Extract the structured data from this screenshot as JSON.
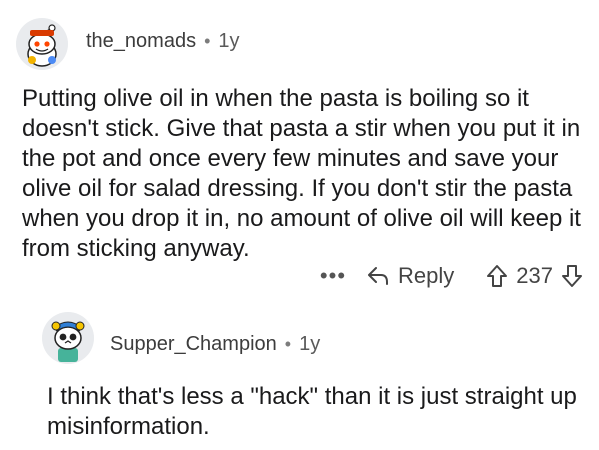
{
  "comments": [
    {
      "username": "the_nomads",
      "separator": "•",
      "age": "1y",
      "text": "Putting olive oil in when the pasta is boiling so it doesn't stick. Give that pasta a stir when you put it in the pot and once every few minutes and save your olive oil for salad dressing. If you don't stir the pasta when you drop it in, no amount of olive oil will keep it from sticking anyway.",
      "actions": {
        "more_label": "•••",
        "reply_label": "Reply",
        "vote_count": "237"
      }
    },
    {
      "username": "Supper_Champion",
      "separator": "•",
      "age": "1y",
      "text": "I think that's less a \"hack\" than it is just straight up misinformation."
    }
  ],
  "icons": [
    "snoo-avatar-icon",
    "reply-arrow-icon",
    "upvote-arrow-icon",
    "downvote-arrow-icon",
    "skull-avatar-icon"
  ]
}
